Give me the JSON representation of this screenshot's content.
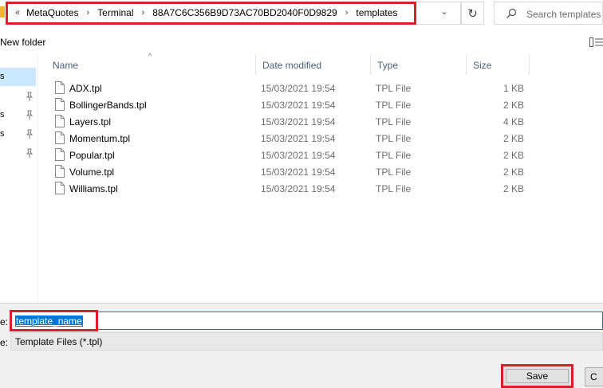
{
  "address": {
    "overflow_glyph": "«",
    "crumbs": [
      "MetaQuotes",
      "Terminal",
      "88A7C6C356B9D73AC70BD2040F0D9829",
      "templates"
    ],
    "separator_glyph": "›",
    "dropdown_glyph": "⌄",
    "refresh_glyph": "↻"
  },
  "search": {
    "placeholder": "Search templates"
  },
  "toolbar": {
    "new_folder_label": "New folder"
  },
  "nav": {
    "items": [
      {
        "tail": "s",
        "selected": true,
        "pinned": false
      },
      {
        "tail": "",
        "selected": false,
        "pinned": true
      },
      {
        "tail": "s",
        "selected": false,
        "pinned": true
      },
      {
        "tail": "s",
        "selected": false,
        "pinned": true
      },
      {
        "tail": "",
        "selected": false,
        "pinned": true
      }
    ]
  },
  "columns": {
    "name": "Name",
    "date": "Date modified",
    "type": "Type",
    "size": "Size",
    "sort_glyph": "^"
  },
  "files": [
    {
      "name": "ADX.tpl",
      "date": "15/03/2021 19:54",
      "type": "TPL File",
      "size": "1 KB"
    },
    {
      "name": "BollingerBands.tpl",
      "date": "15/03/2021 19:54",
      "type": "TPL File",
      "size": "2 KB"
    },
    {
      "name": "Layers.tpl",
      "date": "15/03/2021 19:54",
      "type": "TPL File",
      "size": "4 KB"
    },
    {
      "name": "Momentum.tpl",
      "date": "15/03/2021 19:54",
      "type": "TPL File",
      "size": "2 KB"
    },
    {
      "name": "Popular.tpl",
      "date": "15/03/2021 19:54",
      "type": "TPL File",
      "size": "2 KB"
    },
    {
      "name": "Volume.tpl",
      "date": "15/03/2021 19:54",
      "type": "TPL File",
      "size": "2 KB"
    },
    {
      "name": "Williams.tpl",
      "date": "15/03/2021 19:54",
      "type": "TPL File",
      "size": "2 KB"
    }
  ],
  "footer": {
    "filename_label_tail": "e:",
    "filename_value": "template_name",
    "type_label_tail": "e:",
    "type_value": "Template Files (*.tpl)",
    "save_label": "Save",
    "cancel_label_stub": "C"
  },
  "colors": {
    "highlight_red": "#d9202a",
    "selection_blue": "#0078d7",
    "nav_selected": "#cce8ff"
  }
}
